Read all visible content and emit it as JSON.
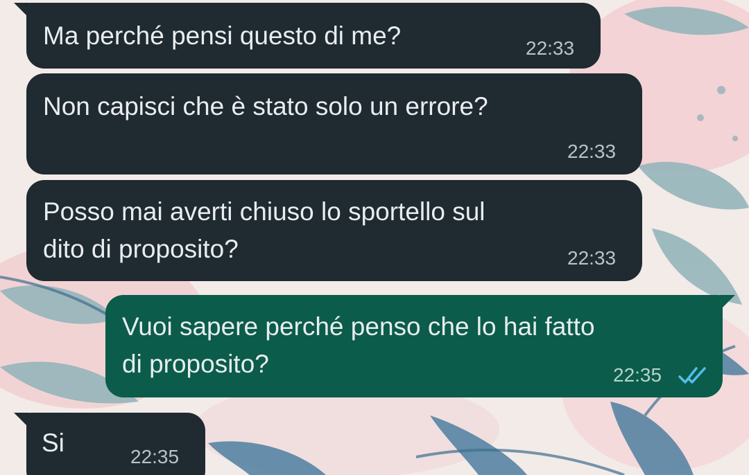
{
  "messages": [
    {
      "text": "Ma perché pensi questo di me?",
      "time": "22:33",
      "direction": "incoming"
    },
    {
      "text_lines": [
        "Non capisci che è stato solo un errore?"
      ],
      "time": "22:33",
      "direction": "incoming"
    },
    {
      "text_lines": [
        "Posso mai averti chiuso lo sportello sul",
        "dito di proposito?"
      ],
      "time": "22:33",
      "direction": "incoming"
    },
    {
      "text_lines": [
        "Vuoi sapere perché penso che lo hai fatto",
        "di proposito?"
      ],
      "time": "22:35",
      "direction": "outgoing",
      "status_icon": "double-check-read-icon"
    },
    {
      "text": "Si",
      "time": "22:35",
      "direction": "incoming"
    }
  ],
  "colors": {
    "incoming_bubble": "#1f2a31",
    "outgoing_bubble": "#0b5c4a",
    "read_check": "#53bdeb",
    "wallpaper_base": "#f3ebe8"
  }
}
